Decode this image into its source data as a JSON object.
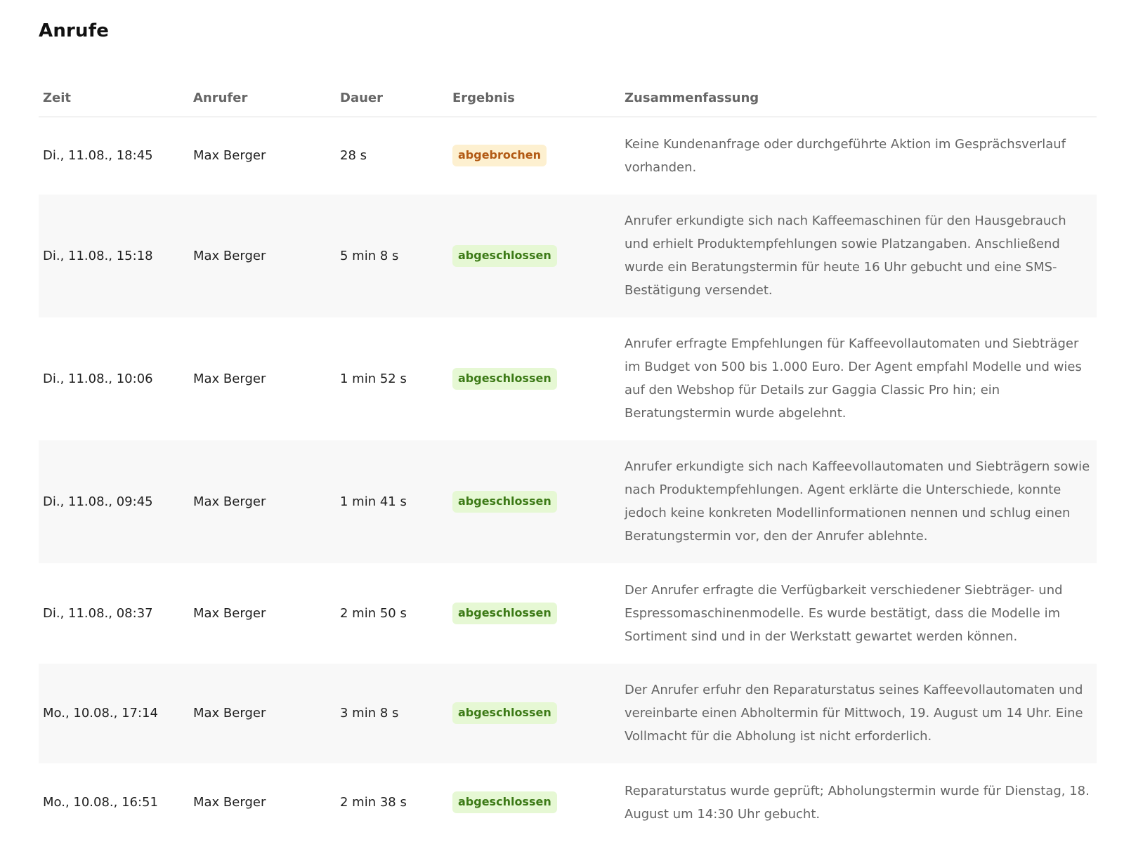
{
  "page": {
    "title": "Anrufe"
  },
  "table": {
    "headers": {
      "zeit": "Zeit",
      "anrufer": "Anrufer",
      "dauer": "Dauer",
      "ergebnis": "Ergebnis",
      "zusammenfassung": "Zusammenfassung"
    },
    "rows": [
      {
        "zeit": "Di., 11.08., 18:45",
        "anrufer": "Max Berger",
        "dauer": "28 s",
        "ergebnis": "abgebrochen",
        "status": "aborted",
        "zusammenfassung": "Keine Kundenanfrage oder durchgeführte Aktion im Gesprächsverlauf vorhanden."
      },
      {
        "zeit": "Di., 11.08., 15:18",
        "anrufer": "Max Berger",
        "dauer": "5 min 8 s",
        "ergebnis": "abgeschlossen",
        "status": "completed",
        "zusammenfassung": "Anrufer erkundigte sich nach Kaffeemaschinen für den Hausgebrauch und erhielt Produktempfehlungen sowie Platzangaben. Anschließend wurde ein Beratungstermin für heute 16 Uhr gebucht und eine SMS-Bestätigung versendet."
      },
      {
        "zeit": "Di., 11.08., 10:06",
        "anrufer": "Max Berger",
        "dauer": "1 min 52 s",
        "ergebnis": "abgeschlossen",
        "status": "completed",
        "zusammenfassung": "Anrufer erfragte Empfehlungen für Kaffeevollautomaten und Siebträger im Budget von 500 bis 1.000 Euro. Der Agent empfahl Modelle und wies auf den Webshop für Details zur Gaggia Classic Pro hin; ein Beratungstermin wurde abgelehnt."
      },
      {
        "zeit": "Di., 11.08., 09:45",
        "anrufer": "Max Berger",
        "dauer": "1 min 41 s",
        "ergebnis": "abgeschlossen",
        "status": "completed",
        "zusammenfassung": "Anrufer erkundigte sich nach Kaffeevollautomaten und Siebträgern sowie nach Produktempfehlungen. Agent erklärte die Unterschiede, konnte jedoch keine konkreten Modellinformationen nennen und schlug einen Beratungstermin vor, den der Anrufer ablehnte."
      },
      {
        "zeit": "Di., 11.08., 08:37",
        "anrufer": "Max Berger",
        "dauer": "2 min 50 s",
        "ergebnis": "abgeschlossen",
        "status": "completed",
        "zusammenfassung": "Der Anrufer erfragte die Verfügbarkeit verschiedener Siebträger- und Espressomaschinenmodelle. Es wurde bestätigt, dass die Modelle im Sortiment sind und in der Werkstatt gewartet werden können."
      },
      {
        "zeit": "Mo., 10.08., 17:14",
        "anrufer": "Max Berger",
        "dauer": "3 min 8 s",
        "ergebnis": "abgeschlossen",
        "status": "completed",
        "zusammenfassung": "Der Anrufer erfuhr den Reparaturstatus seines Kaffeevollautomaten und vereinbarte einen Abholtermin für Mittwoch, 19. August um 14 Uhr. Eine Vollmacht für die Abholung ist nicht erforderlich."
      },
      {
        "zeit": "Mo., 10.08., 16:51",
        "anrufer": "Max Berger",
        "dauer": "2 min 38 s",
        "ergebnis": "abgeschlossen",
        "status": "completed",
        "zusammenfassung": "Reparaturstatus wurde geprüft; Abholungstermin wurde für Dienstag, 18. August um 14:30 Uhr gebucht."
      }
    ]
  },
  "colors": {
    "badge_aborted_bg": "#fdf0d0",
    "badge_aborted_text": "#b25a14",
    "badge_completed_bg": "#e6f8d4",
    "badge_completed_text": "#3c7a16",
    "alt_row_bg": "#f8f8f8"
  }
}
